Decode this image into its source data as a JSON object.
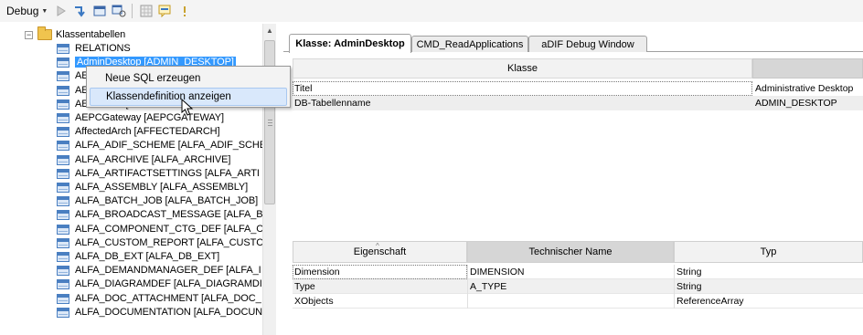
{
  "toolbar": {
    "debug_label": "Debug",
    "buttons": [
      "run-icon",
      "step-into-icon",
      "window-icon",
      "inspect-icon",
      "grid-icon",
      "tooltip-icon",
      "info-icon"
    ]
  },
  "tree": {
    "root_label": "Klassentabellen",
    "items": [
      "RELATIONS",
      "AdminDesktop [ADMIN_DESKTOP]",
      "AEPC",
      "AEPC",
      "AEPCFlow [AEPCFLOW]",
      "AEPCGateway [AEPCGATEWAY]",
      "AffectedArch [AFFECTEDARCH]",
      "ALFA_ADIF_SCHEME [ALFA_ADIF_SCHE",
      "ALFA_ARCHIVE [ALFA_ARCHIVE]",
      "ALFA_ARTIFACTSETTINGS [ALFA_ARTI",
      "ALFA_ASSEMBLY [ALFA_ASSEMBLY]",
      "ALFA_BATCH_JOB [ALFA_BATCH_JOB]",
      "ALFA_BROADCAST_MESSAGE [ALFA_B",
      "ALFA_COMPONENT_CTG_DEF [ALFA_C",
      "ALFA_CUSTOM_REPORT [ALFA_CUSTC",
      "ALFA_DB_EXT [ALFA_DB_EXT]",
      "ALFA_DEMANDMANAGER_DEF [ALFA_I",
      "ALFA_DIAGRAMDEF [ALFA_DIAGRAMDI",
      "ALFA_DOC_ATTACHMENT [ALFA_DOC_",
      "ALFA_DOCUMENTATION [ALFA_DOCUN"
    ]
  },
  "context_menu": {
    "items": [
      "Neue SQL erzeugen",
      "Klassendefinition anzeigen"
    ]
  },
  "tabs": [
    "Klasse: AdminDesktop",
    "CMD_ReadApplications",
    "aDIF Debug Window"
  ],
  "class_grid": {
    "header": "Klasse",
    "rows": [
      {
        "key": "Titel",
        "value": "Administrative Desktop"
      },
      {
        "key": "DB-Tabellenname",
        "value": "ADMIN_DESKTOP"
      }
    ]
  },
  "props_grid": {
    "headers": [
      "Eigenschaft",
      "Technischer Name",
      "Typ"
    ],
    "rows": [
      {
        "eigenschaft": "Dimension",
        "technischer_name": "DIMENSION",
        "typ": "String"
      },
      {
        "eigenschaft": "Type",
        "technischer_name": "A_TYPE",
        "typ": "String"
      },
      {
        "eigenschaft": "XObjects",
        "technischer_name": "",
        "typ": "ReferenceArray"
      }
    ]
  },
  "colors": {
    "selection": "#3399ff",
    "menu_highlight": "#d9e8fb"
  }
}
